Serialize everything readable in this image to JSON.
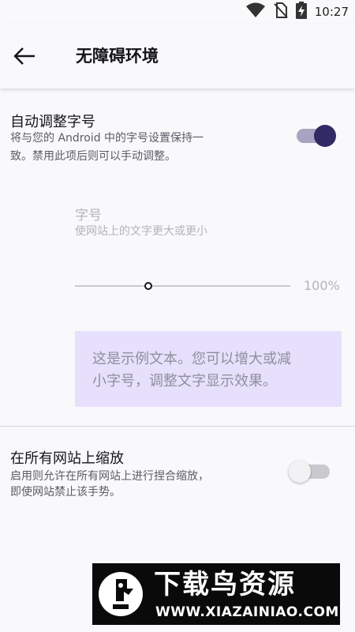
{
  "status_bar": {
    "time": "10:27",
    "icons": [
      "wifi-icon",
      "no-sim-icon",
      "battery-charging-icon"
    ]
  },
  "toolbar": {
    "title": "无障碍环境",
    "back_icon": "arrow-back-icon"
  },
  "auto_font": {
    "title": "自动调整字号",
    "summary_line1": "将与您的 Android 中的字号设置保持一",
    "summary_line2": "致。禁用此项后则可以手动调整。",
    "enabled": true
  },
  "font_size": {
    "title": "字号",
    "summary": "使网站上的文字更大或更小",
    "value": "100%",
    "slider_fraction": 0.34
  },
  "sample": {
    "line1": "这是示例文本。您可以增大或减",
    "line2": "小字号，调整文字显示效果。"
  },
  "zoom": {
    "title": "在所有网站上缩放",
    "summary_line1": "启用则允许在所有网站上进行捏合缩放，",
    "summary_line2": "即使网站禁止该手势。",
    "enabled": false
  },
  "watermark": {
    "brand": "下载鸟资源",
    "url": "WWW.XIAZAINIAO.COM"
  },
  "colors": {
    "accent": "#312a65",
    "accent_track": "#a7a3c0",
    "sample_bg": "#e6e0fc"
  }
}
